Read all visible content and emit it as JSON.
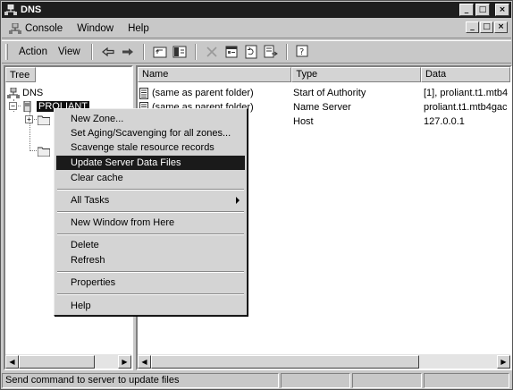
{
  "window": {
    "title": "DNS",
    "controls": {
      "minimize": "_",
      "maximize": "□",
      "close": "×"
    }
  },
  "menubar": {
    "items": [
      {
        "label": "Console"
      },
      {
        "label": "Window"
      },
      {
        "label": "Help"
      }
    ]
  },
  "toolbar": {
    "action_label": "Action",
    "view_label": "View"
  },
  "tree": {
    "header": "Tree",
    "root_label": "DNS",
    "server_label": "PROLIANT"
  },
  "list": {
    "columns": [
      "Name",
      "Type",
      "Data"
    ],
    "rows": [
      {
        "name": "(same as parent folder)",
        "type": "Start of Authority",
        "data": "[1], proliant.t1.mtb4"
      },
      {
        "name": "(same as parent folder)",
        "type": "Name Server",
        "data": "proliant.t1.mtb4gac"
      },
      {
        "name": "",
        "type": "Host",
        "data": "127.0.0.1"
      }
    ]
  },
  "context_menu": {
    "items": [
      {
        "label": "New Zone..."
      },
      {
        "label": "Set Aging/Scavenging for all zones..."
      },
      {
        "label": "Scavenge stale resource records"
      },
      {
        "label": "Update Server Data Files"
      },
      {
        "label": "Clear cache"
      },
      {
        "label": "All Tasks"
      },
      {
        "label": "New Window from Here"
      },
      {
        "label": "Delete"
      },
      {
        "label": "Refresh"
      },
      {
        "label": "Properties"
      },
      {
        "label": "Help"
      }
    ],
    "highlighted": "Update Server Data Files"
  },
  "statusbar": {
    "message": "Send command to server to update files"
  },
  "icons": {
    "back": "back-arrow-icon",
    "forward": "forward-arrow-icon",
    "up": "up-folder-icon",
    "show_tree": "show-hide-tree-icon",
    "delete": "delete-icon",
    "properties": "properties-icon",
    "refresh": "refresh-icon",
    "export": "export-list-icon",
    "help": "help-icon"
  },
  "colors": {
    "selection": "#111111",
    "face": "#d4d4d4",
    "titlebar": "#1e1e1e"
  }
}
